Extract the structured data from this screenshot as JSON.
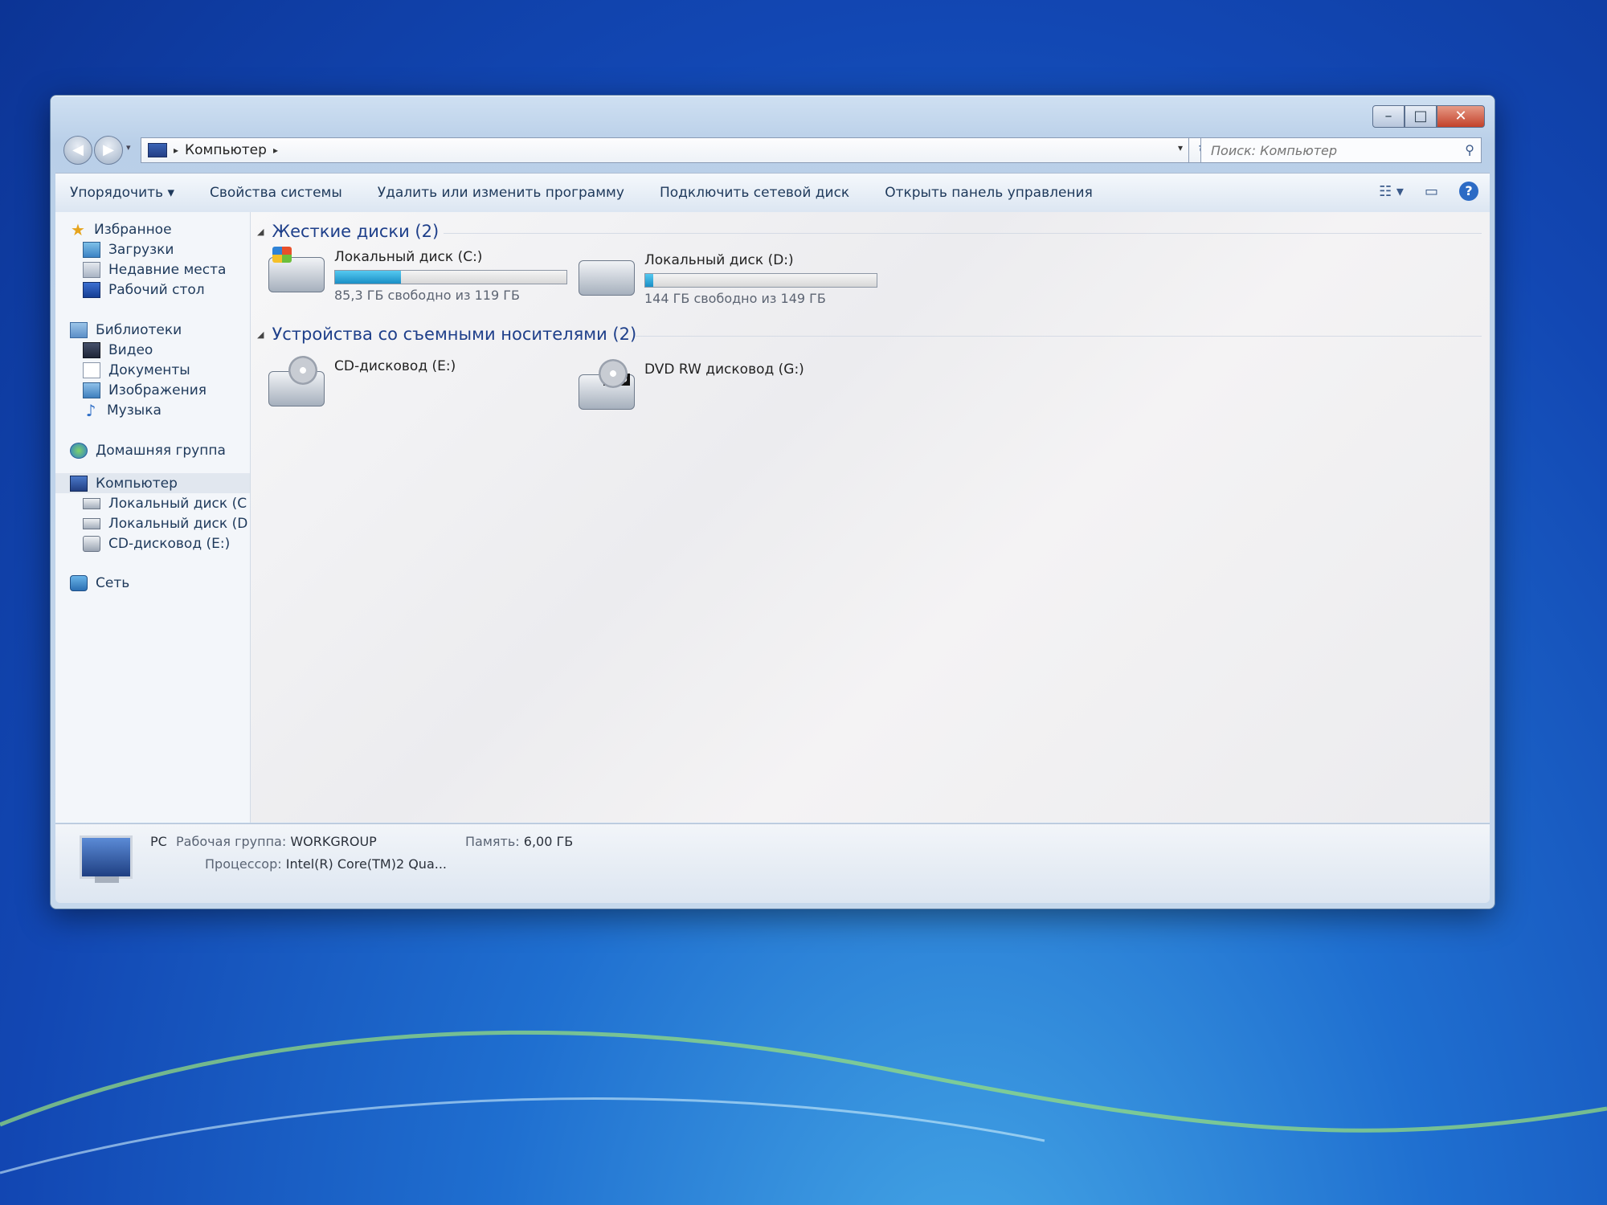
{
  "window": {
    "controls": {
      "minimize": "–",
      "maximize": "□",
      "close": "✕"
    }
  },
  "nav": {
    "back_glyph": "◀",
    "forward_glyph": "▶",
    "address": {
      "root_arrow": "▸",
      "location": "Компьютер",
      "trail_arrow": "▸",
      "dropdown": "▾",
      "refresh": "↻"
    },
    "search_placeholder": "Поиск: Компьютер"
  },
  "toolbar": {
    "organize": "Упорядочить ▾",
    "system_properties": "Свойства системы",
    "uninstall": "Удалить или изменить программу",
    "map_drive": "Подключить сетевой диск",
    "control_panel": "Открыть панель управления",
    "view_glyph": "☷ ▾",
    "preview_glyph": "▭",
    "help_glyph": "?"
  },
  "sidebar": {
    "favorites": {
      "label": "Избранное",
      "items": [
        "Загрузки",
        "Недавние места",
        "Рабочий стол"
      ]
    },
    "libraries": {
      "label": "Библиотеки",
      "items": [
        "Видео",
        "Документы",
        "Изображения",
        "Музыка"
      ]
    },
    "homegroup": "Домашняя группа",
    "computer": {
      "label": "Компьютер",
      "items": [
        "Локальный диск (C",
        "Локальный диск (D",
        "CD-дисковод (E:)"
      ]
    },
    "network": "Сеть"
  },
  "content": {
    "hard_drives": {
      "header": "Жесткие диски (2)",
      "drives": [
        {
          "name": "Локальный диск (C:)",
          "free_text": "85,3 ГБ свободно из 119 ГБ",
          "used_fraction": 0.283
        },
        {
          "name": "Локальный диск (D:)",
          "free_text": "144 ГБ свободно из 149 ГБ",
          "used_fraction": 0.034
        }
      ]
    },
    "removable": {
      "header": "Устройства со съемными носителями (2)",
      "devices": [
        {
          "name": "CD-дисковод (E:)"
        },
        {
          "name": "DVD RW дисковод (G:)",
          "badge": "DVD"
        }
      ]
    }
  },
  "details": {
    "name": "PC",
    "workgroup_label": "Рабочая группа:",
    "workgroup_value": "WORKGROUP",
    "memory_label": "Память:",
    "memory_value": "6,00 ГБ",
    "cpu_label": "Процессор:",
    "cpu_value": "Intel(R) Core(TM)2 Qua..."
  },
  "colors": {
    "accent_bar": "#1a8fc6",
    "header_text": "#1e3f8a",
    "desktop": "#1247b3"
  }
}
